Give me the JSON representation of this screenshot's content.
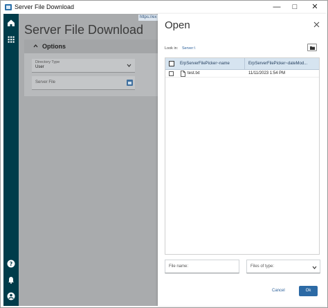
{
  "window": {
    "title": "Server File Download",
    "url_chip": "https://ex",
    "controls": {
      "minimize": "—",
      "maximize": "□",
      "close": "✕"
    }
  },
  "rail": {
    "icons": [
      "home-icon",
      "apps-grid-icon",
      "help-icon",
      "bell-icon",
      "user-icon"
    ]
  },
  "main": {
    "page_title": "Server File Download",
    "options": {
      "header": "Options",
      "directory_type_label": "Directory Type",
      "directory_type_value": "User",
      "server_file_placeholder": "Server File"
    }
  },
  "dialog": {
    "title": "Open",
    "look_in_label": "Look in:",
    "look_in_value": "Server:\\",
    "columns": [
      "ErpServerFilePicker~name",
      "ErpServerFilePicker~dateMod..."
    ],
    "rows": [
      {
        "name": "test.txt",
        "date_modified": "11/11/2023 1:54 PM"
      }
    ],
    "file_name_placeholder": "File name:",
    "file_type_placeholder": "Files of type:",
    "cancel_label": "Cancel",
    "ok_label": "Ok"
  },
  "colors": {
    "rail": "#003c4a",
    "accent": "#2c6aa5",
    "overlay": "#a9abad",
    "grid_header": "#d6e4f0"
  }
}
